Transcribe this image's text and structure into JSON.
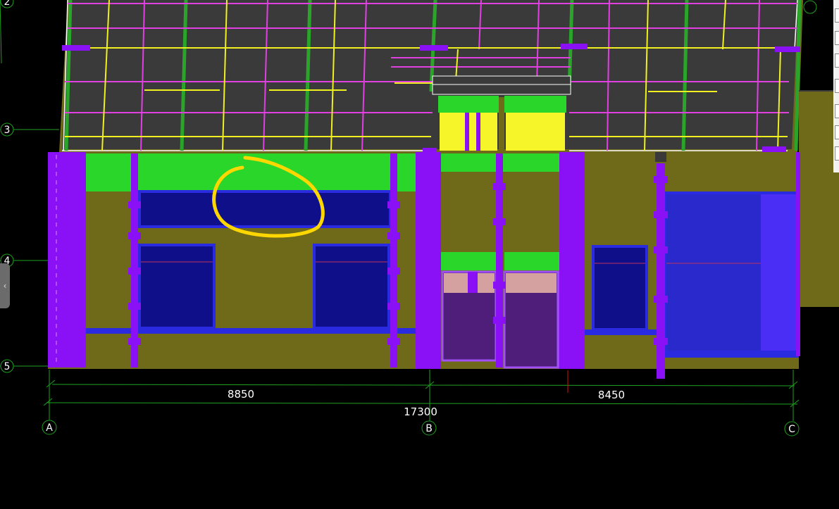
{
  "grid": {
    "rows": [
      "2",
      "3",
      "4",
      "5"
    ],
    "columns": [
      "A",
      "B",
      "C"
    ]
  },
  "dimensions": {
    "span_ab": "8850",
    "span_bc": "8450",
    "total": "17300"
  },
  "colors": {
    "background": "#000000",
    "slab": "#3a3a3a",
    "wall": "#6e6a1a",
    "column": "#8a10f5",
    "beam": "#2ad62a",
    "window": "#0f0f8a",
    "window_frame": "#2a2ae0",
    "markup": "#ffd700"
  },
  "icons": {
    "collapse": "chevron-left-icon"
  }
}
